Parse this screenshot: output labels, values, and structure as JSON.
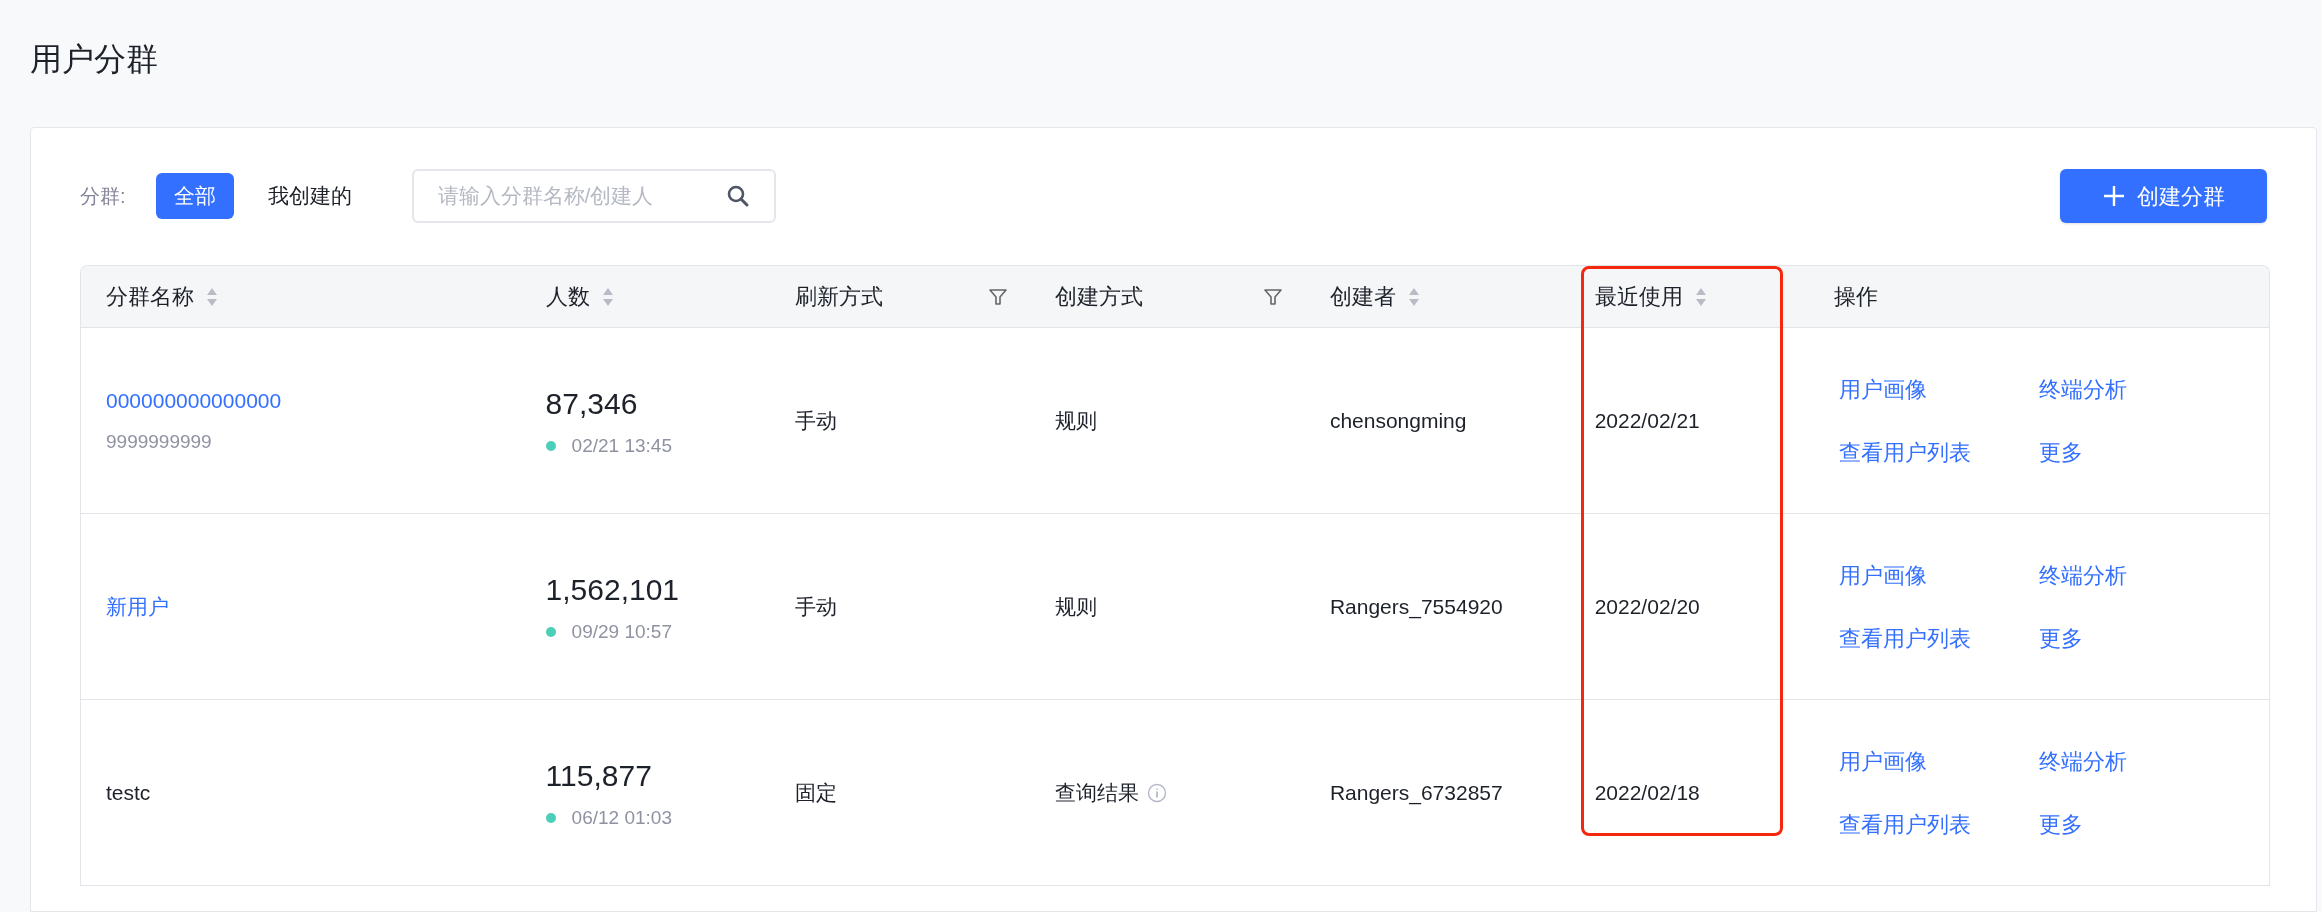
{
  "page": {
    "title": "用户分群"
  },
  "filter": {
    "label": "分群:",
    "tabs": [
      {
        "label": "全部",
        "selected": true
      },
      {
        "label": "我创建的",
        "selected": false
      }
    ],
    "search": {
      "placeholder": "请输入分群名称/创建人"
    }
  },
  "create_button": {
    "label": "创建分群"
  },
  "table": {
    "columns": [
      {
        "label": "分群名称",
        "sortable": true,
        "filterable": false,
        "highlighted": false
      },
      {
        "label": "人数",
        "sortable": true,
        "filterable": false,
        "highlighted": false
      },
      {
        "label": "刷新方式",
        "sortable": false,
        "filterable": true,
        "highlighted": false
      },
      {
        "label": "创建方式",
        "sortable": false,
        "filterable": true,
        "highlighted": false
      },
      {
        "label": "创建者",
        "sortable": true,
        "filterable": false,
        "highlighted": false
      },
      {
        "label": "最近使用",
        "sortable": true,
        "filterable": false,
        "highlighted": true
      },
      {
        "label": "操作",
        "sortable": false,
        "filterable": false,
        "highlighted": false
      }
    ],
    "rows": [
      {
        "name": "000000000000000",
        "link": true,
        "description": "9999999999",
        "count": "87,346",
        "updated": "02/21 13:45",
        "refresh": "手动",
        "create_method": "规则",
        "info": false,
        "creator": "chensongming",
        "last_used": "2022/02/21",
        "actions": [
          "用户画像",
          "终端分析",
          "查看用户列表",
          "更多"
        ]
      },
      {
        "name": "新用户",
        "link": true,
        "count": "1,562,101",
        "updated": "09/29 10:57",
        "refresh": "手动",
        "create_method": "规则",
        "info": false,
        "creator": "Rangers_7554920",
        "last_used": "2022/02/20",
        "actions": [
          "用户画像",
          "终端分析",
          "查看用户列表",
          "更多"
        ]
      },
      {
        "name": "testc",
        "link": false,
        "count": "115,877",
        "updated": "06/12 01:03",
        "refresh": "固定",
        "create_method": "查询结果",
        "info": true,
        "creator": "Rangers_6732857",
        "last_used": "2022/02/18",
        "actions": [
          "用户画像",
          "终端分析",
          "查看用户列表",
          "更多"
        ]
      }
    ]
  }
}
